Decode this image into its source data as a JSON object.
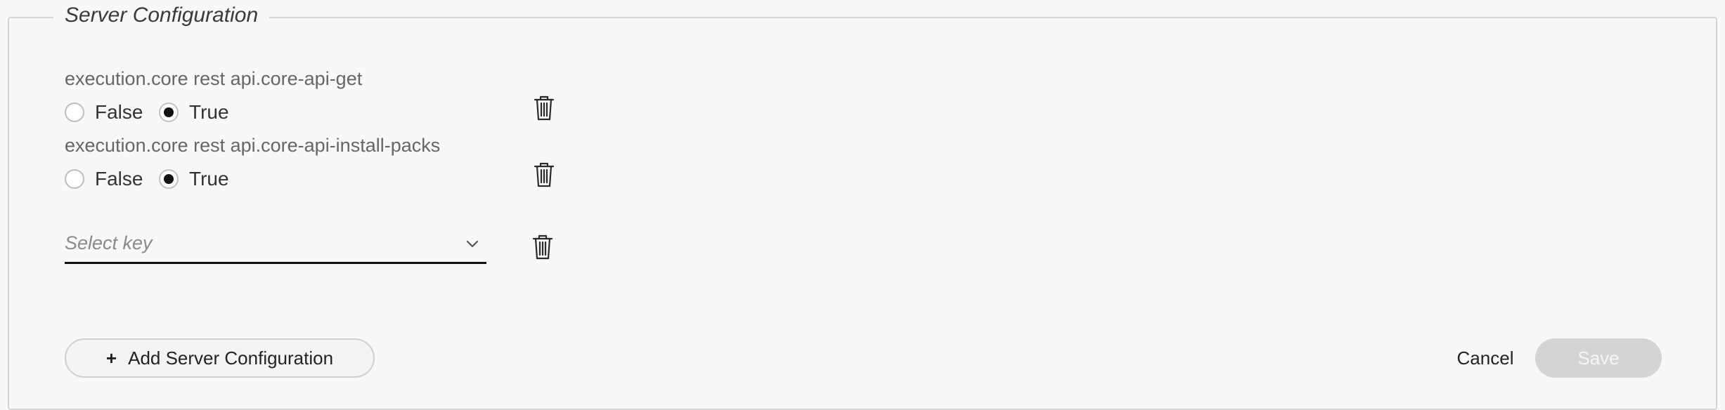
{
  "section": {
    "title": "Server Configuration"
  },
  "settings": [
    {
      "label": "execution.core rest api.core-api-get",
      "options": [
        "False",
        "True"
      ],
      "selected": "True"
    },
    {
      "label": "execution.core rest api.core-api-install-packs",
      "options": [
        "False",
        "True"
      ],
      "selected": "True"
    }
  ],
  "new_entry": {
    "placeholder": "Select key"
  },
  "actions": {
    "add_label": "Add Server Configuration",
    "add_icon": "plus-icon",
    "cancel_label": "Cancel",
    "save_label": "Save",
    "save_enabled": false
  },
  "colors": {
    "background": "#f8f8f8",
    "border": "#d4d4d4",
    "save_disabled_bg": "#d4d4d4",
    "radio_checked": "#111111"
  }
}
